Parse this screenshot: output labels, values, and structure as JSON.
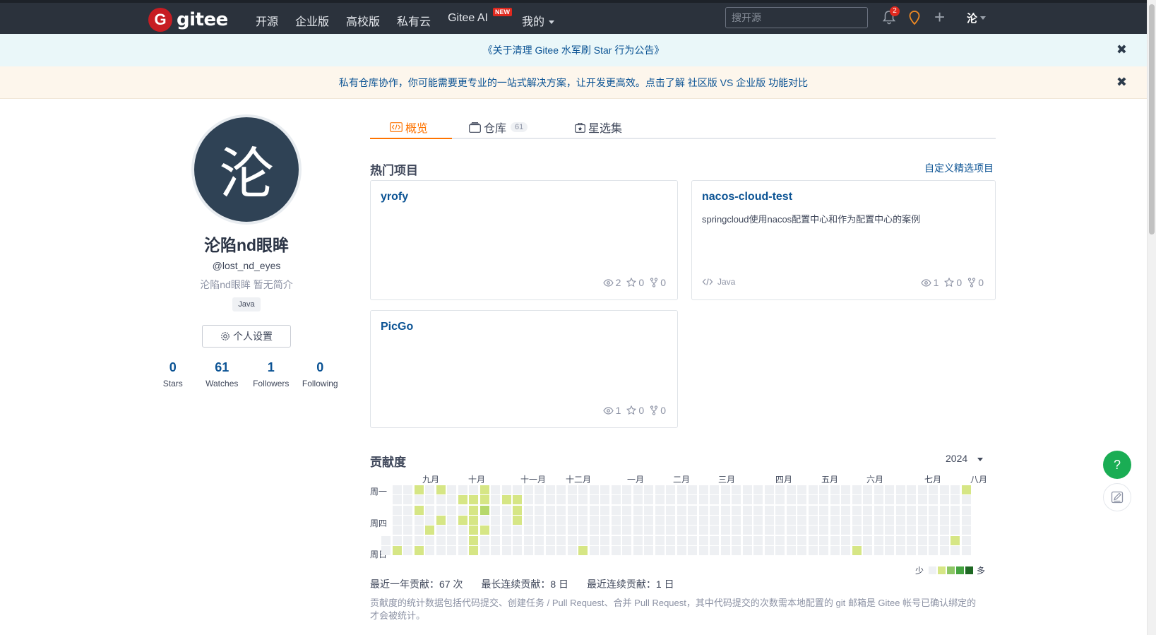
{
  "nav": {
    "logo_mark": "G",
    "logo_text": "gitee",
    "links": [
      "开源",
      "企业版",
      "高校版",
      "私有云",
      "Gitee AI",
      "我的"
    ],
    "new_badge": "NEW",
    "search_placeholder": "搜开源",
    "notif_count": "2",
    "user_initial": "沦"
  },
  "banners": {
    "announcement": "《关于清理 Gitee 水军刷 Star 行为公告》",
    "promo": "私有仓库协作，你可能需要更专业的一站式解决方案，让开发更高效。点击了解 社区版 VS 企业版 功能对比",
    "close": "✖"
  },
  "profile": {
    "avatar_char": "沦",
    "name": "沦陷nd眼眸",
    "handle": "@lost_nd_eyes",
    "bio": "沦陷nd眼眸 暂无简介",
    "tag": "Java",
    "settings_label": "个人设置",
    "stats": [
      {
        "num": "0",
        "label": "Stars"
      },
      {
        "num": "61",
        "label": "Watches"
      },
      {
        "num": "1",
        "label": "Followers"
      },
      {
        "num": "0",
        "label": "Following"
      }
    ]
  },
  "tabs": [
    {
      "label": "概览",
      "count": ""
    },
    {
      "label": "仓库",
      "count": "61"
    },
    {
      "label": "星选集",
      "count": ""
    }
  ],
  "popular": {
    "title": "热门项目",
    "custom_link": "自定义精选项目",
    "projects": [
      {
        "name": "yrofy",
        "desc": "",
        "lang": "",
        "watch": "2",
        "star": "0",
        "fork": "0"
      },
      {
        "name": "nacos-cloud-test",
        "desc": "springcloud使用nacos配置中心和作为配置中心的案例",
        "lang": "Java",
        "watch": "1",
        "star": "0",
        "fork": "0"
      },
      {
        "name": "PicGo",
        "desc": "",
        "lang": "",
        "watch": "1",
        "star": "0",
        "fork": "0"
      }
    ]
  },
  "contrib": {
    "title": "贡献度",
    "year": "2024",
    "months": [
      "九月",
      "十月",
      "十一月",
      "十二月",
      "一月",
      "二月",
      "三月",
      "四月",
      "五月",
      "六月",
      "七月",
      "八月"
    ],
    "days": [
      "周一",
      "周四",
      "周日"
    ],
    "legend_low": "少",
    "legend_high": "多",
    "colors": [
      "#eef0f3",
      "#d6e685",
      "#b6d86b",
      "#8cc665",
      "#44a340",
      "#1e6823"
    ],
    "active_cells": [
      [
        1,
        6,
        1
      ],
      [
        3,
        2,
        1
      ],
      [
        3,
        6,
        1
      ],
      [
        4,
        4,
        1
      ],
      [
        3,
        0,
        1
      ],
      [
        5,
        3,
        1
      ],
      [
        5,
        0,
        1
      ],
      [
        7,
        1,
        1
      ],
      [
        7,
        3,
        1
      ],
      [
        8,
        1,
        1
      ],
      [
        8,
        3,
        1
      ],
      [
        8,
        4,
        1
      ],
      [
        8,
        5,
        1
      ],
      [
        8,
        6,
        1
      ],
      [
        9,
        2,
        2
      ],
      [
        9,
        4,
        1
      ],
      [
        9,
        0,
        1
      ],
      [
        9,
        1,
        1
      ],
      [
        8,
        2,
        1
      ],
      [
        11,
        1,
        1
      ],
      [
        12,
        1,
        1
      ],
      [
        12,
        2,
        1
      ],
      [
        12,
        3,
        1
      ],
      [
        18,
        6,
        1
      ],
      [
        43,
        6,
        1
      ],
      [
        52,
        5,
        1
      ],
      [
        53,
        0,
        1
      ]
    ],
    "stats": [
      "最近一年贡献：67 次",
      "最长连续贡献：8 日",
      "最近连续贡献：1 日"
    ],
    "note": "贡献度的统计数据包括代码提交、创建任务 / Pull Request、合并 Pull Request，其中代码提交的次数需本地配置的 git 邮箱是 Gitee 帐号已确认绑定的才会被统计。"
  },
  "fab": {
    "help": "?"
  }
}
